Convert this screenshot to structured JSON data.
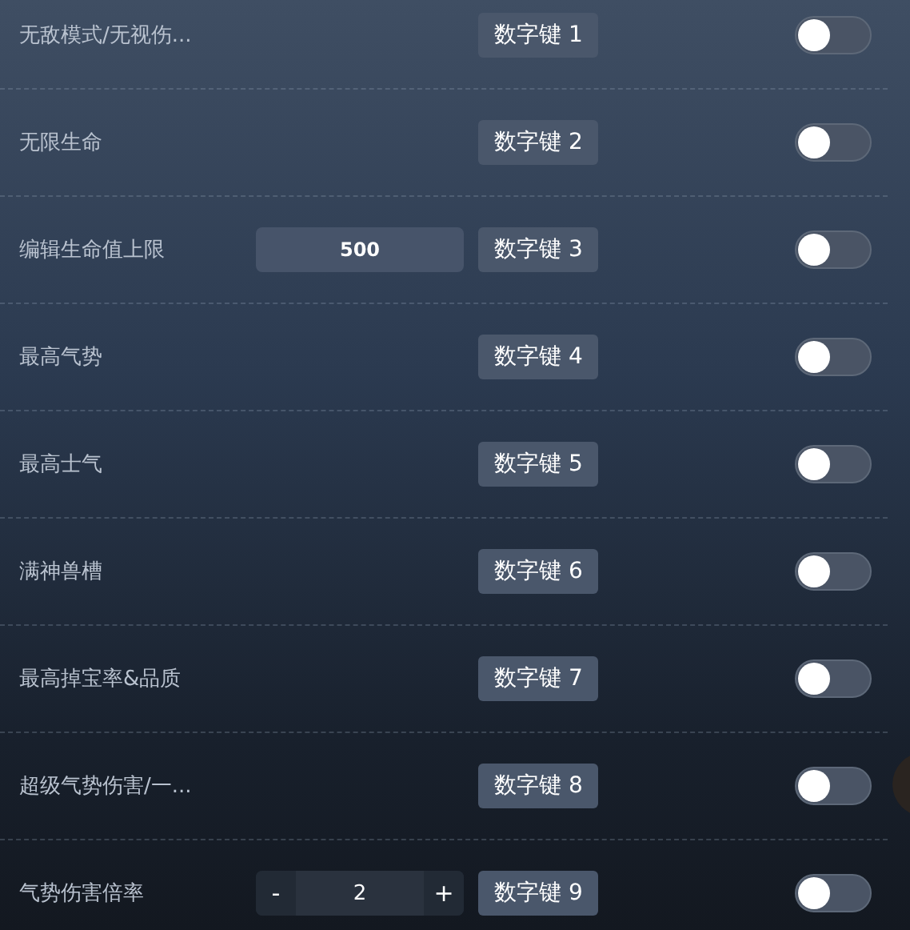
{
  "cheats": [
    {
      "kind": "toggle",
      "label": "无敌模式/无视伤...",
      "hotkey": "数字键 1",
      "on": false
    },
    {
      "kind": "toggle",
      "label": "无限生命",
      "hotkey": "数字键 2",
      "on": false
    },
    {
      "kind": "input",
      "label": "编辑生命值上限",
      "value": "500",
      "hotkey": "数字键 3",
      "on": false
    },
    {
      "kind": "toggle",
      "label": "最高气势",
      "hotkey": "数字键 4",
      "on": false
    },
    {
      "kind": "toggle",
      "label": "最高士气",
      "hotkey": "数字键 5",
      "on": false
    },
    {
      "kind": "toggle",
      "label": "满神兽槽",
      "hotkey": "数字键 6",
      "on": false
    },
    {
      "kind": "toggle",
      "label": "最高掉宝率&品质",
      "hotkey": "数字键 7",
      "on": false
    },
    {
      "kind": "toggle",
      "label": "超级气势伤害/一...",
      "hotkey": "数字键 8",
      "on": false
    },
    {
      "kind": "stepper",
      "label": "气势伤害倍率",
      "value": "2",
      "minus": "-",
      "plus": "+",
      "hotkey": "数字键 9",
      "on": false
    }
  ]
}
